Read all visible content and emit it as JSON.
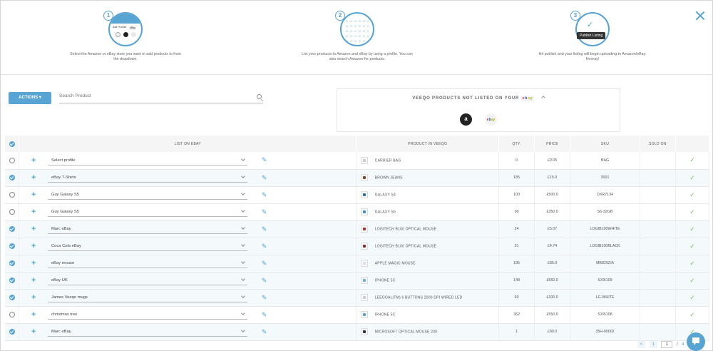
{
  "steps": [
    {
      "num": "1",
      "desc": "Select the Amazon or eBay store you want to add products to from the dropdown.",
      "circle_label": "Add Product",
      "circle_label2": "eBay"
    },
    {
      "num": "2",
      "desc": "List your products to Amazon and eBay by using a profile. You can also search Amazon for products."
    },
    {
      "num": "3",
      "desc": "Hit publish and your listing will begin uploading to Amazon/eBay. Hooray!",
      "tooltip": "Publish Listing"
    }
  ],
  "toolbar": {
    "actions_label": "ACTIONS",
    "search_placeholder": "Search Product"
  },
  "not_listed": {
    "title": "VEEQO PRODUCTS NOT LISTED ON YOUR",
    "amazon_glyph": "a",
    "ebay": [
      "e",
      "b",
      "a",
      "y"
    ]
  },
  "table": {
    "headers": {
      "list_on": "LIST ON EBAY",
      "product": "PRODUCT IN VEEQO",
      "qty": "QTY.",
      "price": "PRICE",
      "sku": "SKU",
      "sold_on": "SOLD ON"
    },
    "rows": [
      {
        "selected": false,
        "profile": "Select profile",
        "product": "CARRIER BAG",
        "qty": "0",
        "price": "£0.05",
        "sku": "BAG",
        "thumb": "#cccccc"
      },
      {
        "selected": true,
        "profile": "eBay T-Shirts",
        "product": "BROWN JEANS",
        "qty": "185",
        "price": "£15.0",
        "sku": "3001",
        "thumb": "#7a4a2a"
      },
      {
        "selected": false,
        "profile": "Guy Galaxy S5",
        "product": "GALAXY S4",
        "qty": "100",
        "price": "£500.0",
        "sku": "DXR7134",
        "thumb": "#2a6fa8"
      },
      {
        "selected": false,
        "profile": "Guy Galaxy S5",
        "product": "GALAXY S6",
        "qty": "90",
        "price": "£350.0",
        "sku": "S6-32GB",
        "thumb": "#3a8fd0"
      },
      {
        "selected": true,
        "profile": "Marc eBay",
        "product": "LOGITECH B100 OPTICAL MOUSE",
        "qty": "24",
        "price": "£5.07",
        "sku": "LOGIB100WHITE",
        "thumb": "#b03030"
      },
      {
        "selected": true,
        "profile": "Coca Cola eBay",
        "product": "LOGITECH B100 OPTICAL MOUSE",
        "qty": "31",
        "price": "£4.74",
        "sku": "LOGIB100BLACK",
        "thumb": "#902828"
      },
      {
        "selected": true,
        "profile": "eBay mouse",
        "product": "APPLE MAGIC MOUSE",
        "qty": "195",
        "price": "£85.0",
        "sku": "MB829Z/A",
        "thumb": "#dddddd"
      },
      {
        "selected": true,
        "profile": "eBay UK",
        "product": "IPHONE 5C",
        "qty": "148",
        "price": "£650.0",
        "sku": "SXI5109",
        "thumb": "#6aaee0"
      },
      {
        "selected": true,
        "profile": "James Veeqo mugs",
        "product": "LEEGOAL(TM) 6 BUTTONS 2000 DPI WIRED LED",
        "qty": "60",
        "price": "£100.0",
        "sku": "LG-WHITE",
        "thumb": "#cccccc"
      },
      {
        "selected": false,
        "profile": "christmas tree",
        "product": "IPHONE 5C",
        "qty": "362",
        "price": "£550.0",
        "sku": "SXI5108",
        "thumb": "#5a9ed0"
      },
      {
        "selected": true,
        "profile": "Marc eBay",
        "product": "MICROSOFT OPTICAL MOUSE 200",
        "qty": "1",
        "price": "£80.0",
        "sku": "35H-00002",
        "thumb": "#333333"
      }
    ]
  },
  "pager": {
    "prev": "<",
    "page_btn": "1",
    "current": "1",
    "sep": "/",
    "total": "4"
  },
  "colors": {
    "accent": "#58a4d3",
    "check": "#7bbf5a"
  },
  "icons": {
    "close": "close-icon",
    "search": "search-icon",
    "edit": "pencil-icon",
    "add": "plus-icon",
    "check": "checkmark-icon",
    "chat": "chat-icon"
  }
}
